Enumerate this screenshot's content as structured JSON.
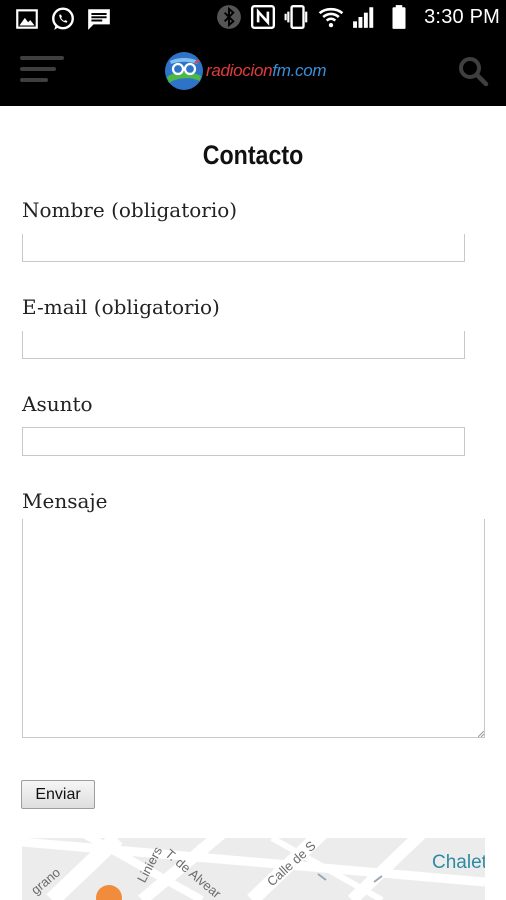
{
  "status_bar": {
    "left_icons": [
      "image-icon",
      "whatsapp-icon",
      "message-icon"
    ],
    "right_icons": [
      "bluetooth-icon",
      "nfc-icon",
      "vibrate-icon",
      "wifi-icon",
      "signal-icon",
      "battery-icon"
    ],
    "time": "3:30 PM"
  },
  "header": {
    "logo_text_main": "radiocion",
    "logo_text_fm": "fm",
    "logo_text_tld": ".com",
    "menu_icon": "hamburger-menu-icon",
    "search_icon": "search-icon"
  },
  "page": {
    "title": "Contacto"
  },
  "form": {
    "name_label": "Nombre (obligatorio)",
    "name_value": "",
    "email_label": "E-mail (obligatorio)",
    "email_value": "",
    "subject_label": "Asunto",
    "subject_value": "",
    "message_label": "Mensaje",
    "message_value": "",
    "submit_label": "Enviar"
  },
  "map": {
    "street_1": "Liniers",
    "street_2": "T. de Alvear",
    "street_3": "Calle de S",
    "street_4": "grano",
    "place": "Chalet"
  },
  "colors": {
    "header_bg": "#000000",
    "accent_blue": "#3a8fd6",
    "map_place": "#2f8aa0"
  }
}
